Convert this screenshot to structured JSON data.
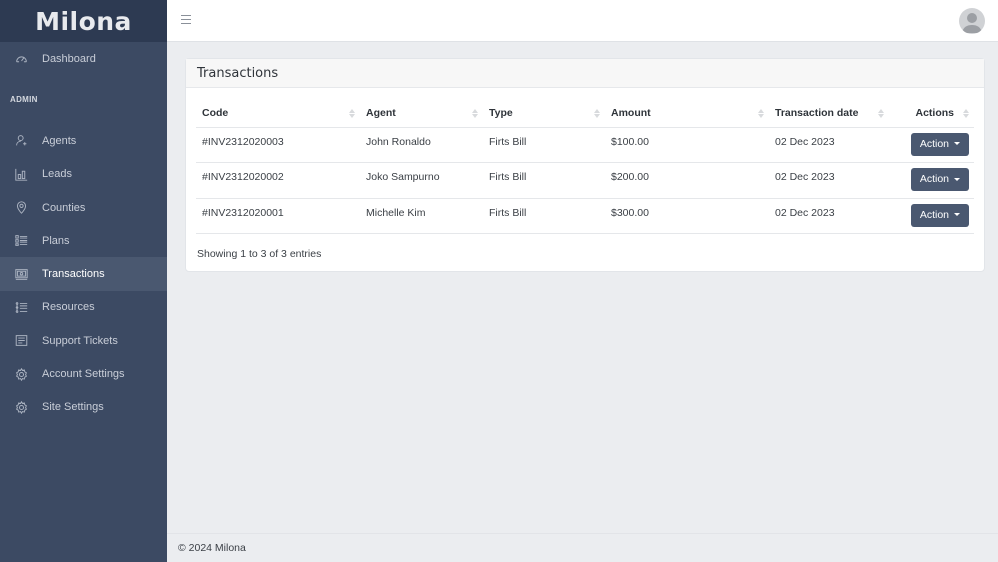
{
  "brand": "Milona",
  "sidebar": {
    "top_items": [
      {
        "label": "Dashboard",
        "icon": "dashboard-gauge-icon"
      }
    ],
    "section_label": "ADMIN",
    "items": [
      {
        "label": "Agents",
        "icon": "user-plus-icon"
      },
      {
        "label": "Leads",
        "icon": "bar-chart-icon"
      },
      {
        "label": "Counties",
        "icon": "map-pin-icon"
      },
      {
        "label": "Plans",
        "icon": "list-icon"
      },
      {
        "label": "Transactions",
        "icon": "money-icon",
        "active": true
      },
      {
        "label": "Resources",
        "icon": "list-check-icon"
      },
      {
        "label": "Support Tickets",
        "icon": "ticket-icon"
      },
      {
        "label": "Account Settings",
        "icon": "gear-icon"
      },
      {
        "label": "Site Settings",
        "icon": "gear-icon"
      }
    ]
  },
  "topbar": {
    "menu_icon": "hamburger-icon",
    "avatar": "user-avatar-icon"
  },
  "card": {
    "title": "Transactions",
    "columns": [
      "Code",
      "Agent",
      "Type",
      "Amount",
      "Transaction date",
      "Actions"
    ],
    "rows": [
      {
        "code": "#INV2312020003",
        "agent": "John Ronaldo",
        "type": "Firts Bill",
        "amount": "$100.00",
        "date": "02 Dec 2023",
        "action": "Action"
      },
      {
        "code": "#INV2312020002",
        "agent": "Joko Sampurno",
        "type": "Firts Bill",
        "amount": "$200.00",
        "date": "02 Dec 2023",
        "action": "Action"
      },
      {
        "code": "#INV2312020001",
        "agent": "Michelle Kim",
        "type": "Firts Bill",
        "amount": "$300.00",
        "date": "02 Dec 2023",
        "action": "Action"
      }
    ],
    "info": "Showing 1 to 3 of 3 entries"
  },
  "footer": "© 2024 Milona"
}
